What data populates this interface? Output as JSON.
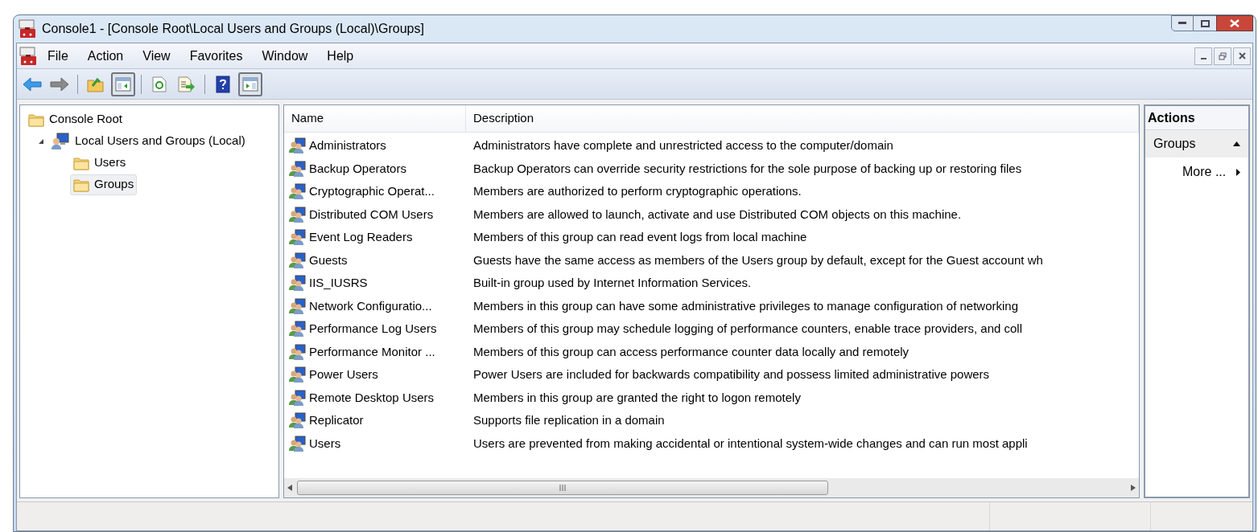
{
  "window": {
    "title": "Console1 - [Console Root\\Local Users and Groups (Local)\\Groups]"
  },
  "menu": [
    {
      "label": "File"
    },
    {
      "label": "Action"
    },
    {
      "label": "View"
    },
    {
      "label": "Favorites"
    },
    {
      "label": "Window"
    },
    {
      "label": "Help"
    }
  ],
  "toolbar": [
    {
      "kind": "back"
    },
    {
      "kind": "forward"
    },
    {
      "kind": "sep"
    },
    {
      "kind": "up"
    },
    {
      "kind": "tree",
      "on": true
    },
    {
      "kind": "sep"
    },
    {
      "kind": "refresh"
    },
    {
      "kind": "export"
    },
    {
      "kind": "sep"
    },
    {
      "kind": "help"
    },
    {
      "kind": "pane",
      "on": true
    }
  ],
  "tree": [
    {
      "label": "Console Root",
      "kind": "folder",
      "selected": false,
      "children": [
        {
          "label": "Local Users and Groups (Local)",
          "kind": "computer",
          "selected": false,
          "expanded": true,
          "children": [
            {
              "label": "Users",
              "kind": "folder",
              "selected": false
            },
            {
              "label": "Groups",
              "kind": "folder",
              "selected": true
            }
          ]
        }
      ]
    }
  ],
  "table": {
    "columns": [
      "Name",
      "Description"
    ],
    "rows": [
      [
        "Administrators",
        "Administrators have complete and unrestricted access to the computer/domain"
      ],
      [
        "Backup Operators",
        "Backup Operators can override security restrictions for the sole purpose of backing up or restoring files"
      ],
      [
        "Cryptographic Operat...",
        "Members are authorized to perform cryptographic operations."
      ],
      [
        "Distributed COM Users",
        "Members are allowed to launch, activate and use Distributed COM objects on this machine."
      ],
      [
        "Event Log Readers",
        "Members of this group can read event logs from local machine"
      ],
      [
        "Guests",
        "Guests have the same access as members of the Users group by default, except for the Guest account wh"
      ],
      [
        "IIS_IUSRS",
        "Built-in group used by Internet Information Services."
      ],
      [
        "Network Configuratio...",
        "Members in this group can have some administrative privileges to manage configuration of networking"
      ],
      [
        "Performance Log Users",
        "Members of this group may schedule logging of performance counters, enable trace providers, and coll"
      ],
      [
        "Performance Monitor ...",
        "Members of this group can access performance counter data locally and remotely"
      ],
      [
        "Power Users",
        "Power Users are included for backwards compatibility and possess limited administrative powers"
      ],
      [
        "Remote Desktop Users",
        "Members in this group are granted the right to logon remotely"
      ],
      [
        "Replicator",
        "Supports file replication in a domain"
      ],
      [
        "Users",
        "Users are prevented from making accidental or intentional system-wide changes and can run most appli"
      ]
    ]
  },
  "actions": {
    "title": "Actions",
    "sections": [
      {
        "label": "Groups",
        "expanded": true,
        "items": [
          {
            "label": "More ..."
          }
        ]
      }
    ]
  }
}
